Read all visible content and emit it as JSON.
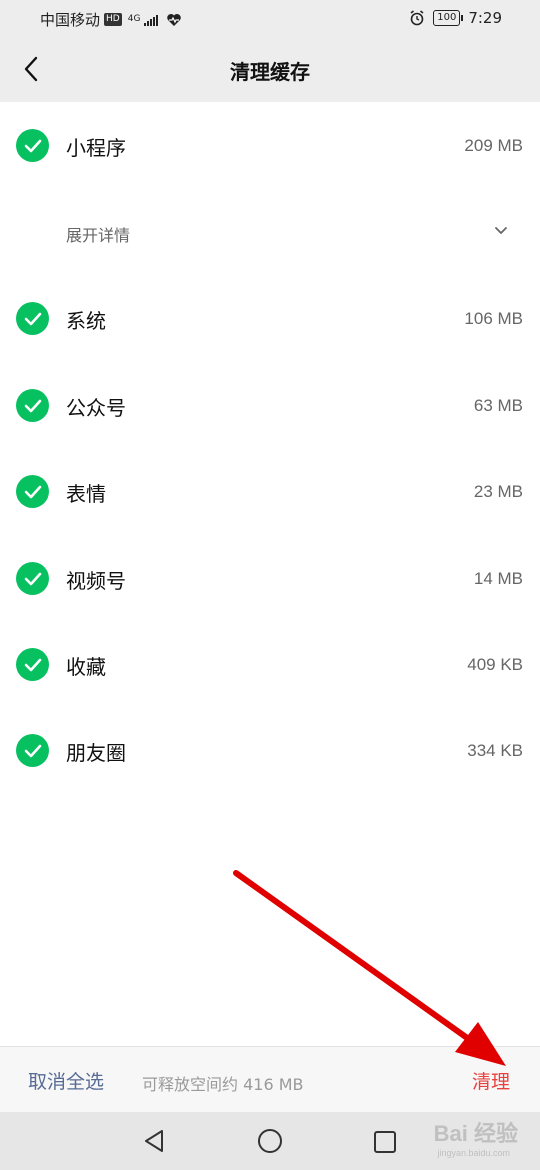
{
  "status_bar": {
    "carrier": "中国移动",
    "hd_badge": "HD",
    "network": "4G",
    "battery": "100",
    "time": "7:29"
  },
  "header": {
    "back_icon": "chevron-left-icon",
    "title": "清理缓存"
  },
  "items": [
    {
      "label": "小程序",
      "size": "209 MB",
      "checked": true
    },
    {
      "label": "系统",
      "size": "106 MB",
      "checked": true
    },
    {
      "label": "公众号",
      "size": "63 MB",
      "checked": true
    },
    {
      "label": "表情",
      "size": "23 MB",
      "checked": true
    },
    {
      "label": "视频号",
      "size": "14 MB",
      "checked": true
    },
    {
      "label": "收藏",
      "size": "409 KB",
      "checked": true
    },
    {
      "label": "朋友圈",
      "size": "334 KB",
      "checked": true
    }
  ],
  "expand": {
    "label": "展开详情",
    "icon": "chevron-down-icon"
  },
  "bottom_bar": {
    "deselect_label": "取消全选",
    "free_space_text": "可释放空间约 416 MB",
    "clean_label": "清理"
  },
  "watermark": {
    "text": "Bai 经验",
    "sub": "jingyan.baidu.com"
  },
  "colors": {
    "accent_green": "#07c160",
    "link_blue": "#576b95",
    "danger_red": "#e64340",
    "arrow_red": "#e00000"
  }
}
